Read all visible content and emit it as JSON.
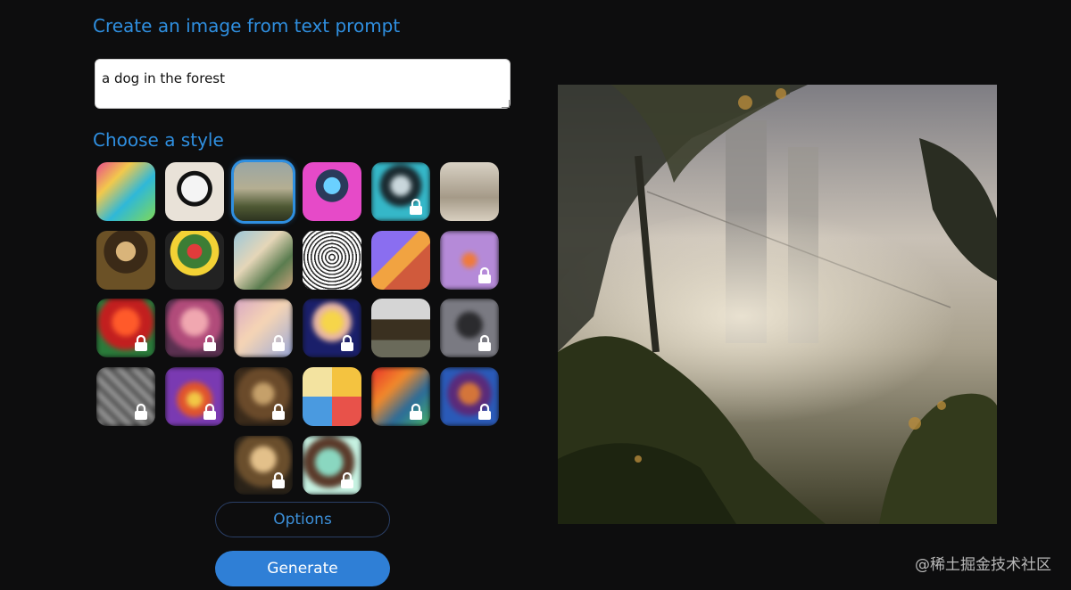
{
  "headings": {
    "create": "Create an image from text prompt",
    "style": "Choose a style"
  },
  "prompt": {
    "value": "a dog in the forest"
  },
  "buttons": {
    "options": "Options",
    "generate": "Generate"
  },
  "colors": {
    "accent": "#2f8fe0",
    "background": "#0d0d0e"
  },
  "styles": [
    {
      "icon": "abstract-art",
      "locked": false,
      "selected": false
    },
    {
      "icon": "panda",
      "locked": false,
      "selected": false
    },
    {
      "icon": "landscape-painting",
      "locked": false,
      "selected": true
    },
    {
      "icon": "robot",
      "locked": false,
      "selected": false
    },
    {
      "icon": "portrait-cyan",
      "locked": true,
      "selected": false
    },
    {
      "icon": "vintage-photo",
      "locked": false,
      "selected": false
    },
    {
      "icon": "mona-lisa",
      "locked": false,
      "selected": false
    },
    {
      "icon": "flower-vase",
      "locked": false,
      "selected": false
    },
    {
      "icon": "ballet-dancers",
      "locked": false,
      "selected": false
    },
    {
      "icon": "engraving-cup",
      "locked": false,
      "selected": false
    },
    {
      "icon": "isometric-3d",
      "locked": false,
      "selected": false
    },
    {
      "icon": "fox-purple",
      "locked": true,
      "selected": false
    },
    {
      "icon": "red-portrait",
      "locked": true,
      "selected": false
    },
    {
      "icon": "pink-portrait",
      "locked": true,
      "selected": false
    },
    {
      "icon": "pastel-blur",
      "locked": true,
      "selected": false
    },
    {
      "icon": "pop-art-portrait",
      "locked": true,
      "selected": false
    },
    {
      "icon": "modern-house",
      "locked": false,
      "selected": false
    },
    {
      "icon": "gray-blur",
      "locked": true,
      "selected": false
    },
    {
      "icon": "gray-texture",
      "locked": true,
      "selected": false
    },
    {
      "icon": "glowing-figure",
      "locked": true,
      "selected": false
    },
    {
      "icon": "brown-blur",
      "locked": true,
      "selected": false
    },
    {
      "icon": "pattern-tiles",
      "locked": false,
      "selected": false
    },
    {
      "icon": "red-dragon",
      "locked": true,
      "selected": false
    },
    {
      "icon": "mosaic-face",
      "locked": true,
      "selected": false
    },
    {
      "icon": "golden-figure",
      "locked": true,
      "selected": false
    },
    {
      "icon": "teal-figure",
      "locked": true,
      "selected": false
    }
  ],
  "watermark": "@稀土掘金技术社区"
}
